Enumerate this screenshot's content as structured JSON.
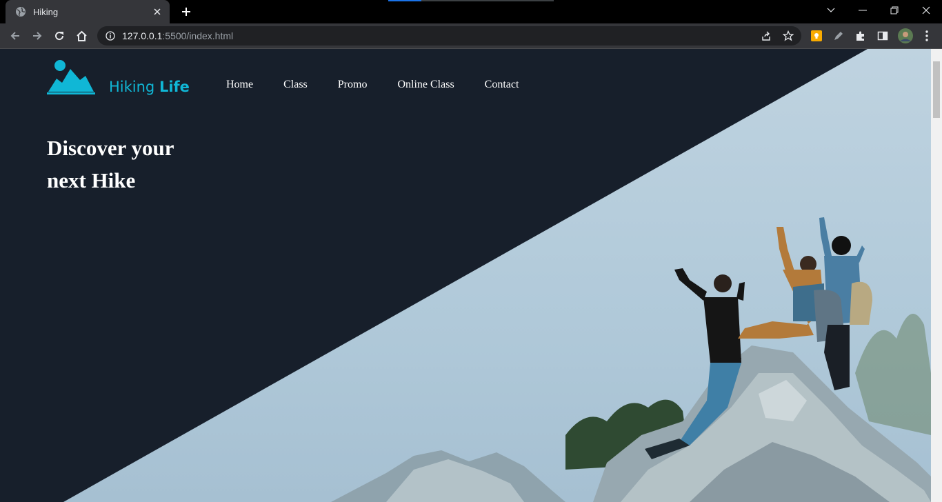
{
  "browser": {
    "tab_title": "Hiking",
    "url_host": "127.0.0.1",
    "url_rest": ":5500/index.html"
  },
  "site": {
    "logo_word1": "Hiking",
    "logo_word2": "Life",
    "brand_color": "#10b7d6",
    "background_color": "#171f2b",
    "nav": [
      "Home",
      "Class",
      "Promo",
      "Online Class",
      "Contact"
    ],
    "hero_line1": "Discover your",
    "hero_line2": "next Hike"
  },
  "icons": {
    "tab": "globe-icon",
    "tab_close": "close-icon",
    "new_tab": "plus-icon",
    "back": "arrow-left-icon",
    "forward": "arrow-right-icon",
    "reload": "reload-icon",
    "home": "home-icon",
    "info": "info-icon",
    "share": "share-icon",
    "bookmark": "star-icon",
    "extensions": "puzzle-icon"
  }
}
